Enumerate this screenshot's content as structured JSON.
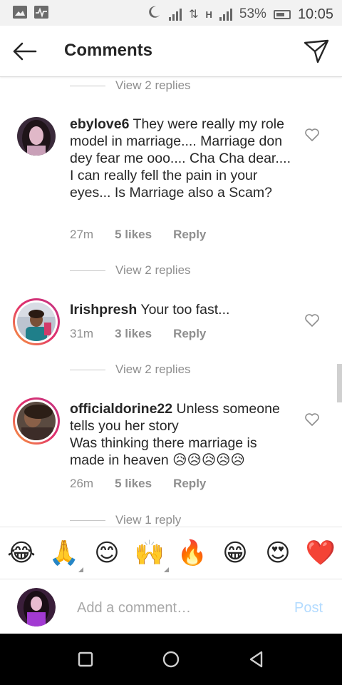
{
  "status_bar": {
    "battery": "53%",
    "time": "10:05",
    "network_h_label": "H",
    "data_arrows": "⇅"
  },
  "header": {
    "title": "Comments",
    "back_icon": "arrow-left-icon",
    "send_icon": "paper-plane-icon"
  },
  "top_view_replies": "View 2 replies",
  "comments": [
    {
      "username": "ebylove6",
      "text": "They were really my role model in marriage.... Marriage don dey fear me ooo.... Cha Cha dear.... I can really fell the pain in your eyes... Is Marriage also a Scam?",
      "time": "27m",
      "likes": "5 likes",
      "reply": "Reply",
      "view_replies": "View 2 replies"
    },
    {
      "username": "Irishpresh",
      "text": "Your too fast...",
      "time": "31m",
      "likes": "3 likes",
      "reply": "Reply",
      "view_replies": "View 2 replies"
    },
    {
      "username": "officialdorine22",
      "text": "Unless someone tells you her story\nWas thinking there marriage is made in heaven 😥😥😥😥😥",
      "time": "26m",
      "likes": "5 likes",
      "reply": "Reply",
      "view_replies": "View 1 reply"
    }
  ],
  "emoji_bar": [
    "😂",
    "🙏",
    "😊",
    "🙌",
    "🔥",
    "😁",
    "😍",
    "❤️"
  ],
  "comment_input": {
    "placeholder": "Add a comment…",
    "post_label": "Post"
  },
  "colors": {
    "accent_post_disabled": "#b3dbff",
    "secondary_text": "#8e8e8e",
    "primary_text": "#262626",
    "story_ring": "#e1306c"
  }
}
